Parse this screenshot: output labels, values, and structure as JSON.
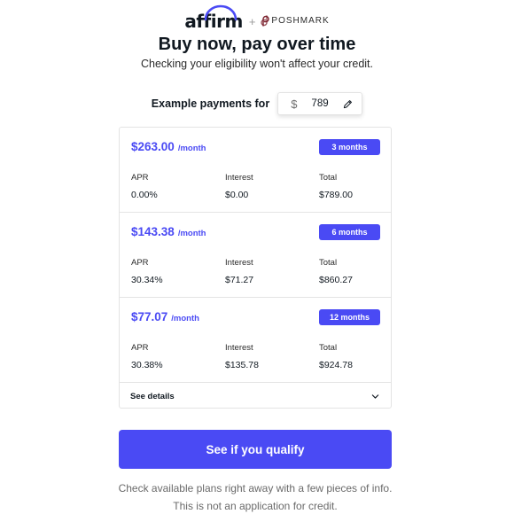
{
  "header": {
    "brand": "affirm",
    "separator": "+",
    "partner": "POSHMARK",
    "title": "Buy now, pay over time",
    "subtitle": "Checking your eligibility won't affect your credit."
  },
  "example": {
    "label": "Example payments for",
    "currency_symbol": "$",
    "amount": "789"
  },
  "columns": {
    "apr": "APR",
    "interest": "Interest",
    "total": "Total"
  },
  "plans": [
    {
      "monthly": "$263.00",
      "unit": "/month",
      "term": "3 months",
      "apr": "0.00%",
      "interest": "$0.00",
      "total": "$789.00"
    },
    {
      "monthly": "$143.38",
      "unit": "/month",
      "term": "6 months",
      "apr": "30.34%",
      "interest": "$71.27",
      "total": "$860.27"
    },
    {
      "monthly": "$77.07",
      "unit": "/month",
      "term": "12 months",
      "apr": "30.38%",
      "interest": "$135.78",
      "total": "$924.78"
    }
  ],
  "details": {
    "label": "See details"
  },
  "cta": {
    "label": "See if you qualify"
  },
  "footer": {
    "line1": "Check available plans right away with a few pieces of info.",
    "line2": "This is not an application for credit."
  },
  "colors": {
    "accent": "#4a4af4",
    "text": "#101820",
    "muted": "#6a6a6a",
    "border": "#e4e4e4"
  },
  "icons": [
    "pencil-icon",
    "chevron-down-icon",
    "poshmark-logo-icon"
  ]
}
